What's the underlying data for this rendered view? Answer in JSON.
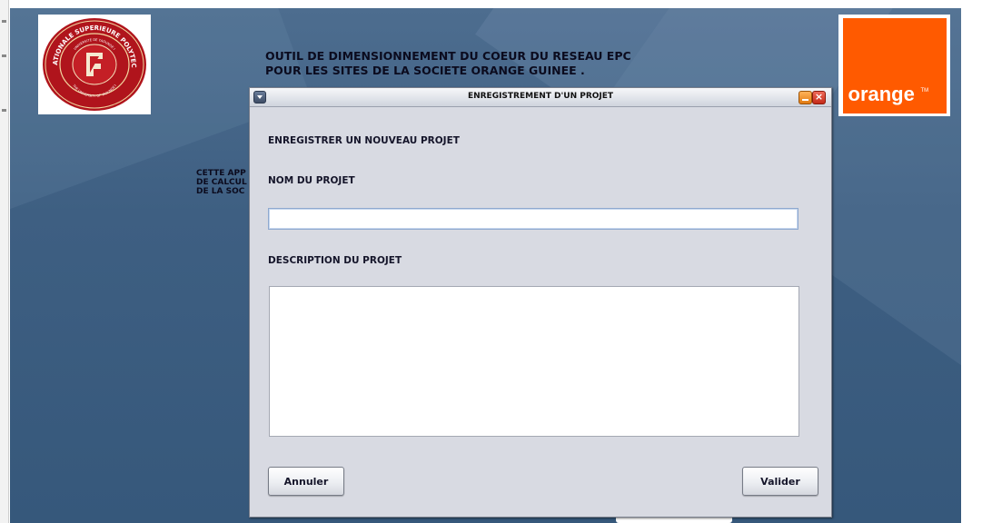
{
  "app": {
    "title_line1": "OUTIL DE DIMENSIONNEMENT DU COEUR DU RESEAU EPC",
    "title_line2": "POUR LES SITES DE LA SOCIETE ORANGE GUINEE .",
    "desc_line1": "CETTE APP",
    "desc_line2": "DE CALCUL",
    "desc_line3": "DE LA SOC"
  },
  "logos": {
    "school_outer_text": "ECOLE NATIONALE SUPERIEURE POLYTECHNIQUE",
    "school_inner_top": "UNIVERSITE DE YAOUNDE I",
    "school_inner_bottom": "THE UNIVERSITY OF YAOUNDE I",
    "orange_word": "orange",
    "orange_tm": "TM"
  },
  "dialog": {
    "title": "ENREGISTREMENT D'UN PROJET",
    "heading": "ENREGISTRER UN NOUVEAU PROJET",
    "name_label": "NOM DU PROJET",
    "name_value": "",
    "description_label": "DESCRIPTION DU PROJET",
    "description_value": "",
    "cancel_label": "Annuler",
    "ok_label": "Valider"
  },
  "colors": {
    "background": "#3e5f82",
    "orange_brand": "#ff5a00",
    "school_red": "#b0141c",
    "dialog_bg": "#d8dae2"
  },
  "icons": {
    "menu": "window-menu-icon",
    "minimize": "minimize-icon",
    "close": "close-icon"
  }
}
